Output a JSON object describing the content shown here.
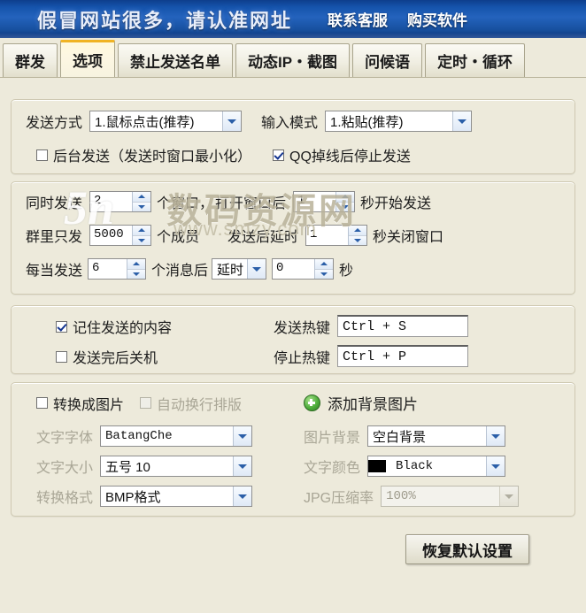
{
  "banner": {
    "title": "假冒网站很多，请认准网址",
    "links": [
      "联系客服",
      "购买软件"
    ],
    "bg_color": "#1553ab"
  },
  "tabs": [
    {
      "label": "群发",
      "selected": false
    },
    {
      "label": "选项",
      "selected": true
    },
    {
      "label": "禁止发送名单",
      "selected": false
    },
    {
      "label": "动态IP・截图",
      "selected": false
    },
    {
      "label": "问候语",
      "selected": false
    },
    {
      "label": "定时・循环",
      "selected": false
    }
  ],
  "group_send": {
    "send_method_label": "发送方式",
    "send_method_value": "1.鼠标点击(推荐)",
    "input_mode_label": "输入模式",
    "input_mode_value": "1.粘贴(推荐)",
    "background_send": {
      "label": "后台发送（发送时窗口最小化）",
      "checked": false
    },
    "stop_on_offline": {
      "label": "QQ掉线后停止发送",
      "checked": true
    }
  },
  "group_timing": {
    "concurrent_prefix": "同时发送",
    "concurrent_value": "2",
    "concurrent_mid": "个窗口，",
    "open_delay_prefix": "打开窗口后",
    "open_delay_value": "1",
    "open_delay_suffix": "秒开始发送",
    "group_limit_prefix": "群里只发",
    "group_limit_value": "5000",
    "group_limit_suffix": "个成员",
    "close_delay_prefix": "发送后延时",
    "close_delay_value": "1",
    "close_delay_suffix": "秒关闭窗口",
    "every_prefix": "每当发送",
    "every_value": "6",
    "every_mid": "个消息后",
    "action_value": "延时",
    "action_seconds": "0",
    "action_suffix": "秒"
  },
  "group_hotkey": {
    "remember_content": {
      "label": "记住发送的内容",
      "checked": true
    },
    "shutdown_after": {
      "label": "发送完后关机",
      "checked": false
    },
    "send_hotkey_label": "发送热键",
    "send_hotkey_value": "Ctrl + S",
    "stop_hotkey_label": "停止热键",
    "stop_hotkey_value": "Ctrl + P"
  },
  "group_image": {
    "convert_to_image": {
      "label": "转换成图片",
      "checked": false
    },
    "auto_wrap": {
      "label": "自动换行排版",
      "checked": false,
      "disabled": true
    },
    "add_background_label": "添加背景图片",
    "add_background_icon": "green-plus-icon",
    "font_label": "文字字体",
    "font_value": "BatangChe",
    "image_bg_label": "图片背景",
    "image_bg_value": "空白背景",
    "font_size_label": "文字大小",
    "font_size_value": "五号 10",
    "font_color_label": "文字颜色",
    "font_color_value": "Black",
    "font_color_hex": "#000000",
    "format_label": "转换格式",
    "format_value": "BMP格式",
    "jpg_quality_label": "JPG压缩率",
    "jpg_quality_value": "100%"
  },
  "footer": {
    "restore_defaults_label": "恢复默认设置"
  },
  "watermark": {
    "logo_text": "5n",
    "site_name": "数码资源网",
    "url": "www.smzy.com"
  }
}
